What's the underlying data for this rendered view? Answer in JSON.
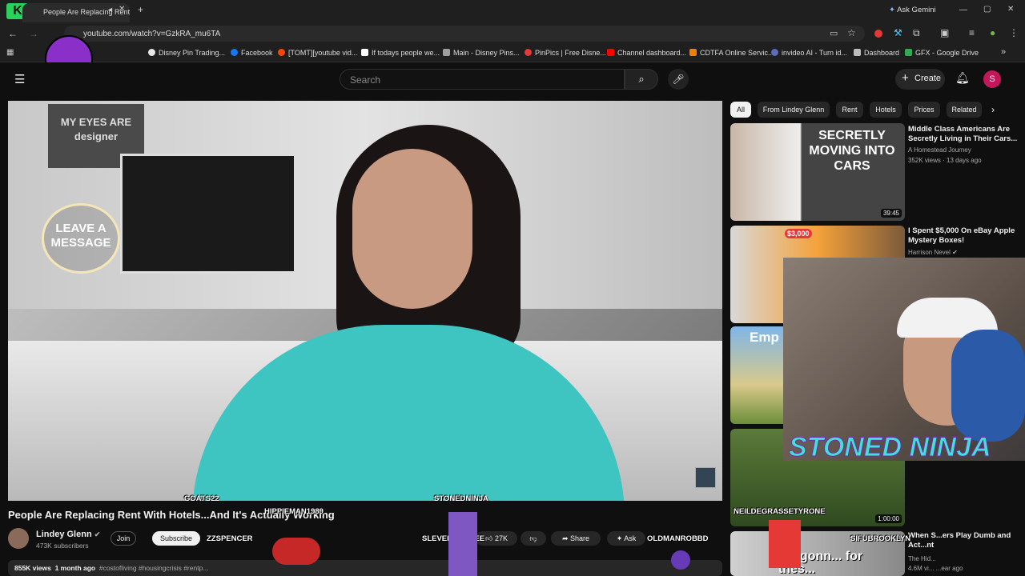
{
  "browser": {
    "tab_title": "People Are Replacing Rent",
    "tab_logo": "K",
    "tab_number": "6",
    "ask_gemini": "Ask Gemini",
    "url": "youtube.com/watch?v=GzkRA_mu6TA"
  },
  "bookmarks": [
    {
      "label": "Disney Pin Trading...",
      "color": "#e6e6e6"
    },
    {
      "label": "Facebook",
      "color": "#1877f2"
    },
    {
      "label": "[TOMT][youtube vid...",
      "color": "#ff4500"
    },
    {
      "label": "If todays people we...",
      "color": "#ffffff"
    },
    {
      "label": "Main - Disney Pins...",
      "color": "#9e9e9e"
    },
    {
      "label": "PinPics | Free Disne...",
      "color": "#e53935"
    },
    {
      "label": "Channel dashboard...",
      "color": "#ff0000"
    },
    {
      "label": "CDTFA Online Servic...",
      "color": "#f57c00"
    },
    {
      "label": "invideo AI - Turn id...",
      "color": "#5c6bc0"
    },
    {
      "label": "Dashboard",
      "color": "#bdbdbd"
    },
    {
      "label": "GFX - Google Drive",
      "color": "#34a853"
    }
  ],
  "youtube": {
    "search_placeholder": "Search",
    "create_label": "Create",
    "avatar_letter": "S"
  },
  "video": {
    "title": "People Are Replacing Rent With Hotels...And It's Actually Working",
    "channel": "Lindey Glenn",
    "subscribers": "473K subscribers",
    "join": "Join",
    "subscribe": "Subscribe",
    "likes": "27K",
    "share": "Share",
    "ask": "Ask",
    "views": "855K views",
    "age": "1 month ago",
    "hashtags": "#costofliving #housingcrisis #rentp...",
    "wall_sign": "LEAVE A MESSAGE",
    "poster_text": "MY EYES ARE designer"
  },
  "chips": [
    "All",
    "From Lindey Glenn",
    "Rent",
    "Hotels",
    "Prices",
    "Related"
  ],
  "recommended": [
    {
      "title": "Middle Class Americans Are Secretly Living in Their Cars...",
      "channel": "A Homestead Journey",
      "meta": "352K views · 13 days ago",
      "duration": "39:45",
      "thumb_text": "SECRETLY MOVING INTO CARS"
    },
    {
      "title": "I Spent $5,000 On eBay Apple Mystery Boxes!",
      "channel": "Harrison Nevel",
      "meta": "",
      "duration": "",
      "thumb_text": "$3,000"
    },
    {
      "title": "",
      "channel": "",
      "meta": "",
      "duration": "",
      "thumb_text": "Emp"
    },
    {
      "title": "",
      "channel": "",
      "meta": "",
      "duration": "1:00:00",
      "thumb_text": ""
    },
    {
      "title": "When S...ers Play Dumb and Act...nt",
      "channel": "The Hid...",
      "meta": "4.6M vi... ...ear ago",
      "duration": "",
      "thumb_text": "I'm gonn... for thes..."
    }
  ],
  "stream_overlay": {
    "streamer_name": "STONED NINJA",
    "chat_names": [
      "GOATS22",
      "STONEDNINJA",
      "HIPPIEMAN1989",
      "ZZSPENCER",
      "SLEVENDEGREE",
      "OLDMANROBBD",
      "NEILDEGRASSETYRONE",
      "SIFUBROOKLYN"
    ]
  }
}
